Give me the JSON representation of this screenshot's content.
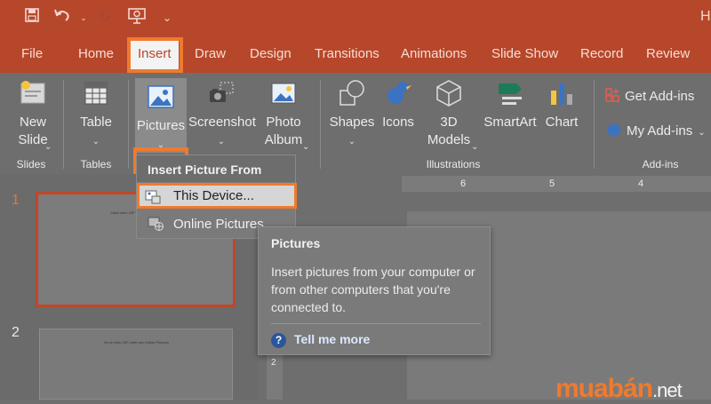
{
  "title_bar": {
    "app_title": "H"
  },
  "tabs": [
    "File",
    "Home",
    "Insert",
    "Draw",
    "Design",
    "Transitions",
    "Animations",
    "Slide Show",
    "Record",
    "Review"
  ],
  "ribbon": {
    "buttons": {
      "new_slide": "New Slide",
      "table": "Table",
      "pictures": "Pictures",
      "screenshot": "Screenshot",
      "photo_album": "Photo Album",
      "shapes": "Shapes",
      "icons": "Icons",
      "models_3d": "3D Models",
      "smartart": "SmartArt",
      "chart": "Chart",
      "get_addins": "Get Add-ins",
      "my_addins": "My Add-ins"
    },
    "groups": {
      "slides": "Slides",
      "tables": "Tables",
      "illustrations": "Illustrations",
      "addins": "Add-ins"
    }
  },
  "dropdown": {
    "header": "Insert Picture From",
    "items": [
      "This Device...",
      "Online Pictures"
    ]
  },
  "tooltip": {
    "title": "Pictures",
    "body": "Insert pictures from your computer or from other computers that you're connected to.",
    "link": "Tell me more"
  },
  "slides": [
    {
      "number": "1",
      "caption": "Cách chèn GIF vào PowerPoint"
    },
    {
      "number": "2",
      "caption": "Tải về chèn GIF, bấm vào Online Pictures"
    }
  ],
  "ruler": {
    "h_marks": [
      "6",
      "5",
      "4"
    ],
    "v_mark": "2"
  },
  "watermark": {
    "brand": "muabán",
    "tld": ".net"
  },
  "colors": {
    "accent": "#b7472a",
    "highlight": "#f07a2d",
    "link_icon": "#2b579a"
  }
}
